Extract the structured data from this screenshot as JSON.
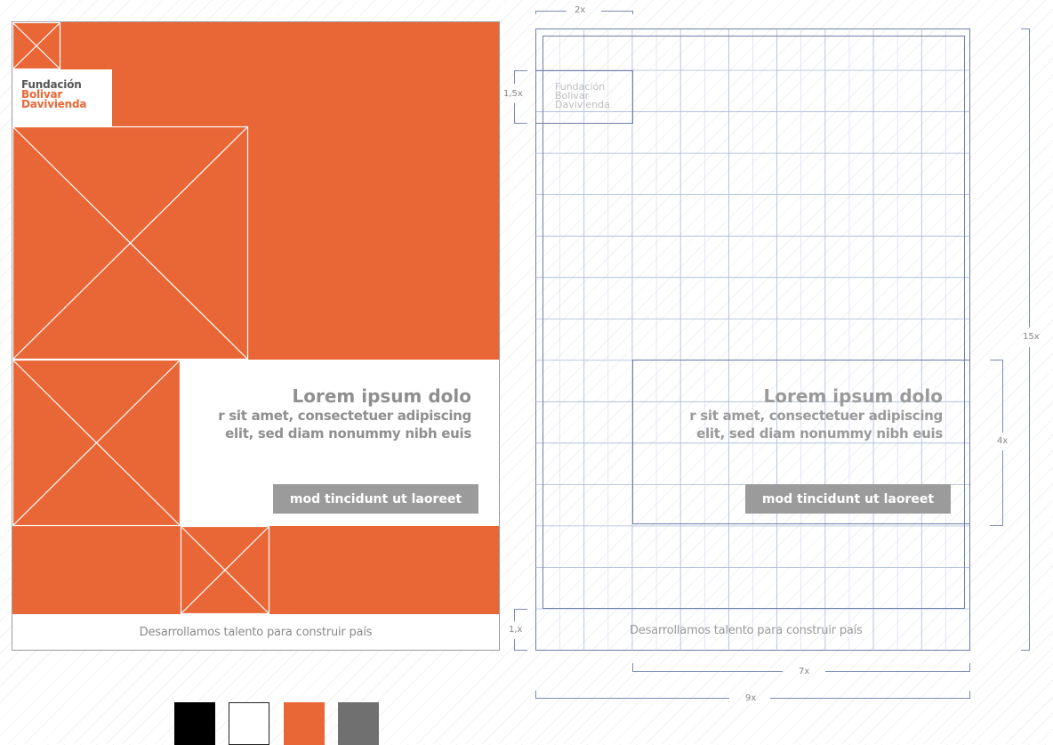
{
  "logo": {
    "line1": "Fundación",
    "line2": "Bolivar",
    "line3": "Davivienda"
  },
  "headline": {
    "title": "Lorem ipsum dolo",
    "line2": "r sit amet, consectetuer adipiscing",
    "line3": "elit, sed diam nonummy nibh euis"
  },
  "cta_label": "mod tincidunt ut laoreet",
  "tagline": "Desarrollamos talento para construir país",
  "dimensions": {
    "top_width": "2x",
    "logo_height": "1,5x",
    "total_height": "15x",
    "content_height": "4x",
    "footer_height": "1,x",
    "content_width": "7x",
    "total_width": "9x"
  },
  "colors": {
    "brand_orange": "#E96737",
    "black": "#000000",
    "white": "#FFFFFF",
    "gray": "#707070",
    "grid_line": "#9fb0d6"
  },
  "palette": [
    {
      "name": "black",
      "hex": "#000000"
    },
    {
      "name": "white",
      "hex": "#FFFFFF"
    },
    {
      "name": "orange",
      "hex": "#E96737"
    },
    {
      "name": "gray",
      "hex": "#707070"
    }
  ]
}
